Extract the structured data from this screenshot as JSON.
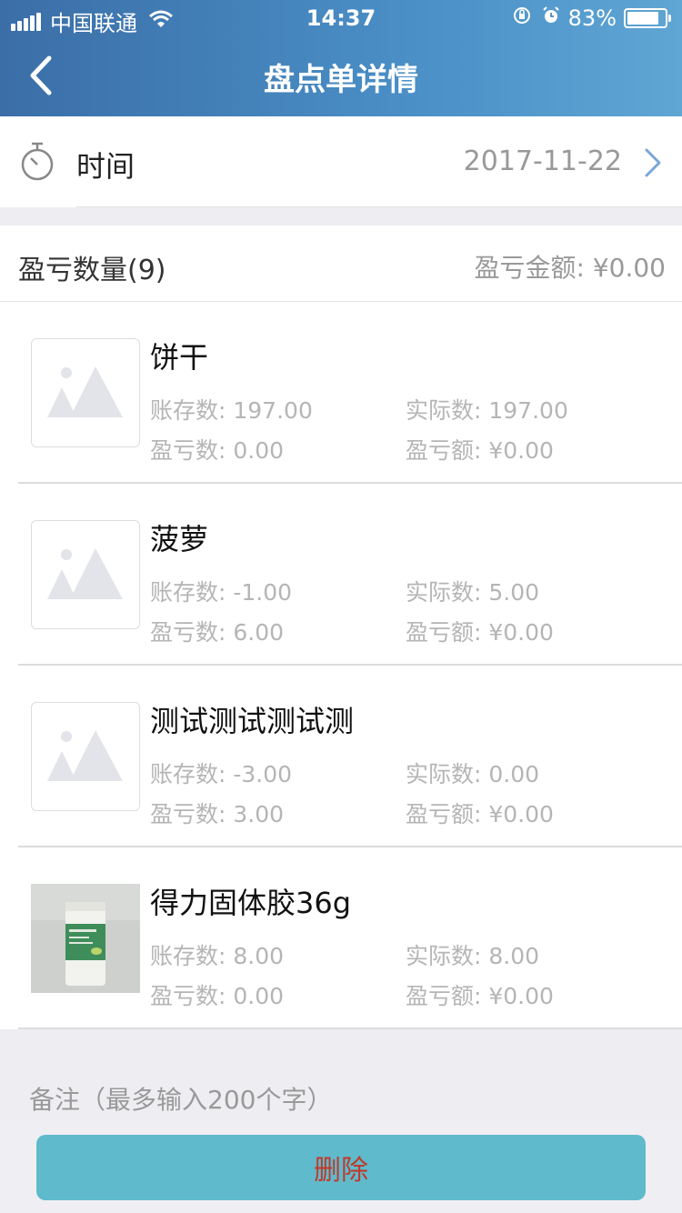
{
  "status_bar": {
    "carrier": "中国联通",
    "time": "14:37",
    "battery": "83%"
  },
  "nav": {
    "title": "盘点单详情",
    "back_icon": "chevron-left-icon"
  },
  "date_row": {
    "label": "时间",
    "value": "2017-11-22",
    "icon": "stopwatch-icon"
  },
  "summary": {
    "count_label": "盈亏数量(9)",
    "amount_label": "盈亏金额: ¥0.00"
  },
  "items": [
    {
      "name": "饼干",
      "stock": "账存数: 197.00",
      "actual": "实际数: 197.00",
      "diff_qty": "盈亏数: 0.00",
      "diff_amount": "盈亏额: ¥0.00",
      "image": "placeholder-image-icon"
    },
    {
      "name": "菠萝",
      "stock": "账存数: -1.00",
      "actual": "实际数: 5.00",
      "diff_qty": "盈亏数: 6.00",
      "diff_amount": "盈亏额: ¥0.00",
      "image": "placeholder-image-icon"
    },
    {
      "name": "测试测试测试测",
      "stock": "账存数: -3.00",
      "actual": "实际数: 0.00",
      "diff_qty": "盈亏数: 3.00",
      "diff_amount": "盈亏额: ¥0.00",
      "image": "placeholder-image-icon"
    },
    {
      "name": "得力固体胶36g",
      "stock": "账存数: 8.00",
      "actual": "实际数: 8.00",
      "diff_qty": "盈亏数: 0.00",
      "diff_amount": "盈亏额: ¥0.00",
      "image": "glue-stick-photo"
    }
  ],
  "remark_placeholder": "备注（最多输入200个字）",
  "delete_button": "删除",
  "colors": {
    "header_start": "#3b6ea7",
    "header_end": "#5fa6d4",
    "button_bg": "#5fbacb",
    "button_text": "#c0392b"
  }
}
